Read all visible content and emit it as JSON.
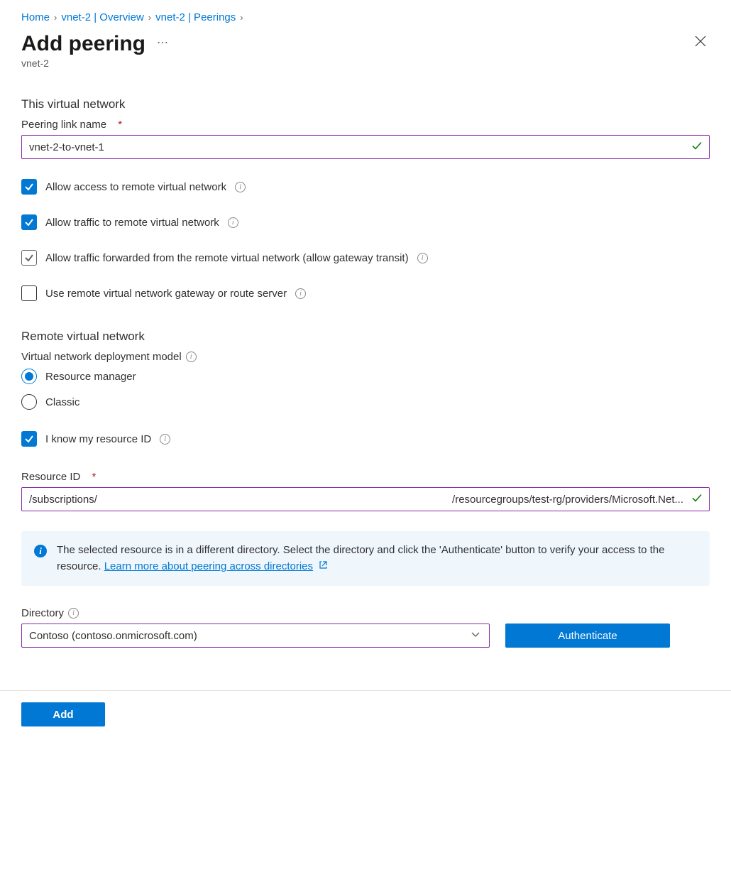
{
  "breadcrumb": {
    "home": "Home",
    "overview": "vnet-2 | Overview",
    "peerings": "vnet-2 | Peerings"
  },
  "header": {
    "title": "Add peering",
    "subtitle": "vnet-2"
  },
  "this_vnet": {
    "heading": "This virtual network",
    "link_name_label": "Peering link name",
    "link_name_value": "vnet-2-to-vnet-1",
    "checks": {
      "allow_access": "Allow access to remote virtual network",
      "allow_traffic": "Allow traffic to remote virtual network",
      "allow_forwarded": "Allow traffic forwarded from the remote virtual network (allow gateway transit)",
      "use_gateway": "Use remote virtual network gateway or route server"
    }
  },
  "remote_vnet": {
    "heading": "Remote virtual network",
    "deploy_model_label": "Virtual network deployment model",
    "radio_rm": "Resource manager",
    "radio_classic": "Classic",
    "know_id_label": "I know my resource ID",
    "resource_id_label": "Resource ID",
    "resource_id_left": "/subscriptions/",
    "resource_id_right": "/resourcegroups/test-rg/providers/Microsoft.Net..."
  },
  "infobox": {
    "text": "The selected resource is in a different directory. Select the directory and click the 'Authenticate' button to verify your access to the resource. ",
    "link": "Learn more about peering across directories"
  },
  "directory": {
    "label": "Directory",
    "value": "Contoso (contoso.onmicrosoft.com)",
    "auth_button": "Authenticate"
  },
  "footer": {
    "add": "Add"
  }
}
